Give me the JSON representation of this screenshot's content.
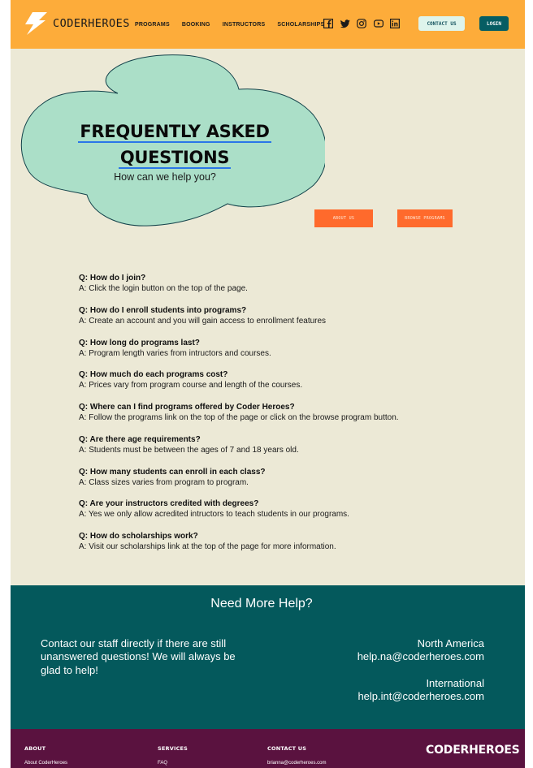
{
  "header": {
    "logo_text": "CODERHEROES",
    "nav": [
      "PROGRAMS",
      "BOOKING",
      "INSTRUCTORS",
      "SCHOLARSHIPS"
    ],
    "social_icons": [
      "facebook-icon",
      "twitter-icon",
      "instagram-icon",
      "youtube-icon",
      "linkedin-icon"
    ],
    "contact_label": "CONTACT US",
    "login_label": "LOGIN"
  },
  "hero": {
    "title_line1": "FREQUENTLY ASKED",
    "title_line2": "QUESTIONS",
    "subtitle": "How can we help you?",
    "about_label": "ABOUT US",
    "browse_label": "BROWSE PROGRAMS"
  },
  "faq": [
    {
      "q": "Q: How do I join?",
      "a": "A: Click the login button on the top of the page."
    },
    {
      "q": "Q: How do I enroll students into programs?",
      "a": "A: Create an account and you will gain access to enrollment features"
    },
    {
      "q": "Q: How long do programs last?",
      "a": "A: Program length varies from intructors and courses."
    },
    {
      "q": "Q: How much do each programs cost?",
      "a": "A:  Prices vary from program course and length of the courses."
    },
    {
      "q": "Q: Where can I find programs offered by Coder Heroes?",
      "a": "A: Follow the programs link on the top of the page or click on the browse program button."
    },
    {
      "q": "Q: Are there age requirements?",
      "a": "A: Students must be between the ages of 7 and 18 years old."
    },
    {
      "q": "Q: How many students can enroll in each class?",
      "a": "A: Class sizes varies from program to program."
    },
    {
      "q": "Q: Are your instructors credited with degrees?",
      "a": "A: Yes we only allow acredited intructors to teach students in our programs."
    },
    {
      "q": "Q: How do scholarships work?",
      "a": "A: Visit our scholarships link at the top of the page for more information."
    }
  ],
  "help": {
    "title": "Need More Help?",
    "text": "Contact our staff directly if there are still unanswered questions! We will always be glad to help!",
    "na_region": "North America",
    "na_email": "help.na@coderheroes.com",
    "intl_region": "International",
    "intl_email": "help.int@coderheroes.com"
  },
  "footer": {
    "about_head": "ABOUT",
    "about_link": "About CoderHeroes",
    "services_head": "SERVICES",
    "services_link": "FAQ",
    "contact_head": "CONTACT US",
    "contact_link": "brianna@coderheroes.com",
    "brand": "CODERHEROES"
  },
  "colors": {
    "header_bg": "#fdac3a",
    "page_bg": "#ece9d6",
    "cloud_fill": "#abdfc8",
    "accent_orange": "#ff6a2c",
    "help_bg": "#04595c",
    "footer_bg": "#5a123f",
    "link_underline": "#2a76e8"
  }
}
